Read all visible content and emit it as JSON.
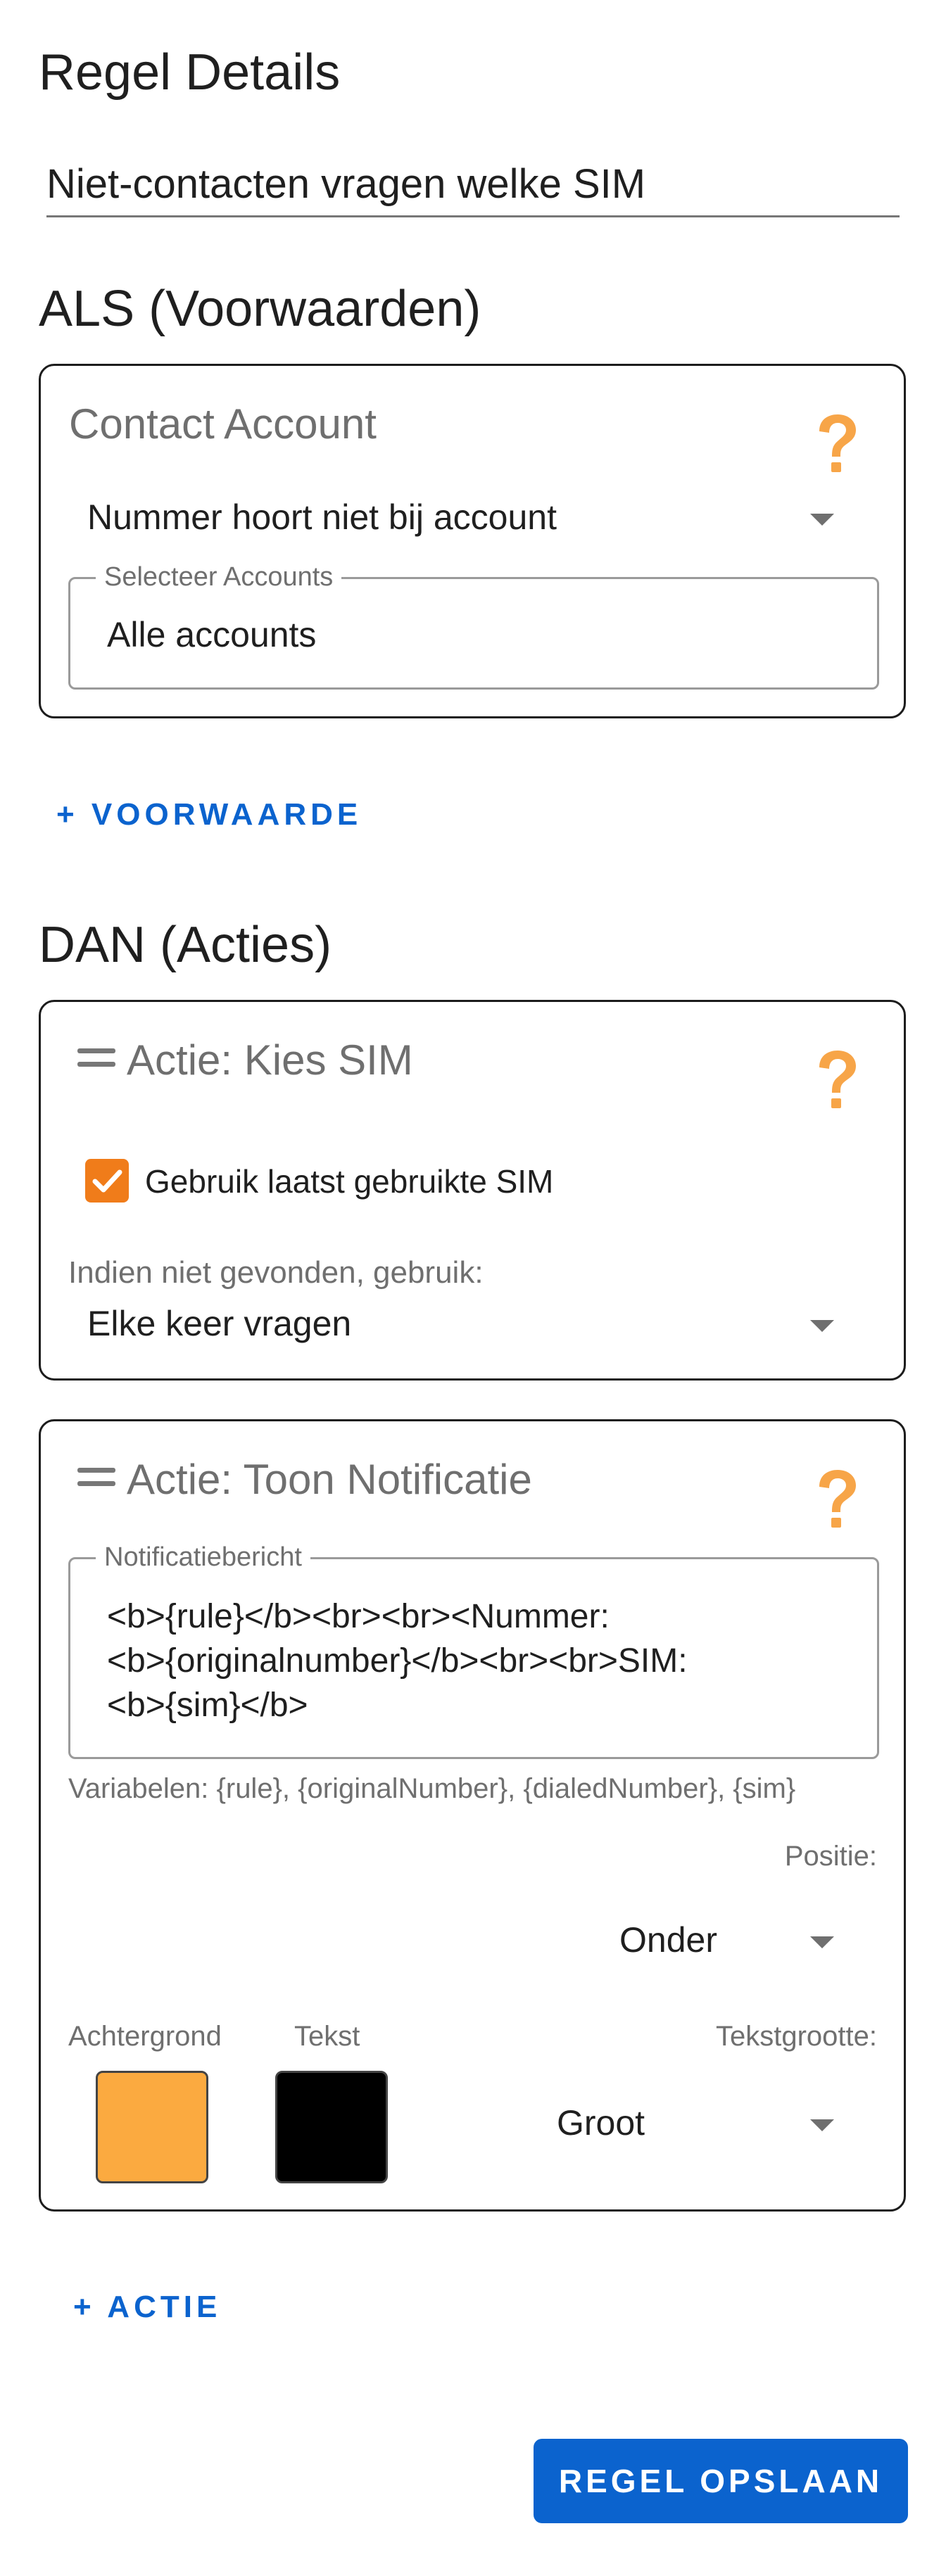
{
  "page": {
    "heading": "Regel Details",
    "rule_name": "Niet-contacten vragen welke SIM"
  },
  "conditions": {
    "heading": "ALS (Voorwaarden)",
    "contact_account": {
      "title": "Contact Account",
      "help_icon": "question-mark-icon",
      "select_value": "Nummer hoort niet bij account",
      "accounts_label": "Selecteer Accounts",
      "accounts_value": "Alle accounts"
    },
    "add_condition_label": "+ VOORWAARDE"
  },
  "actions": {
    "heading": "DAN (Acties)",
    "choose_sim": {
      "title": "Actie: Kies SIM",
      "drag_icon": "drag-handle-icon",
      "help_icon": "question-mark-icon",
      "checkbox_label": "Gebruik laatst gebruikte SIM",
      "checkbox_checked": true,
      "fallback_label": "Indien niet gevonden, gebruik:",
      "fallback_value": "Elke keer vragen"
    },
    "show_notification": {
      "title": "Actie: Toon Notificatie",
      "drag_icon": "drag-handle-icon",
      "help_icon": "question-mark-icon",
      "message_label": "Notificatiebericht",
      "message_line1": "<b>{rule}</b><br><br><Nummer:",
      "message_line2": "<b>{originalnumber}</b><br><br>SIM:",
      "message_line3": "<b>{sim}</b>",
      "variables_hint": "Variabelen: {rule}, {originalNumber}, {dialedNumber}, {sim}",
      "position_label": "Positie:",
      "position_value": "Onder",
      "background_label": "Achtergrond",
      "background_color": "#FBAA40",
      "text_label": "Tekst",
      "text_color": "#000000",
      "text_size_label": "Tekstgrootte:",
      "text_size_value": "Groot"
    },
    "add_action_label": "+ ACTIE"
  },
  "footer": {
    "save_label": "REGEL OPSLAAN"
  },
  "colors": {
    "accent_blue": "#0B63CE",
    "help_orange": "#F7A548",
    "checkbox_orange": "#F07C1A"
  }
}
